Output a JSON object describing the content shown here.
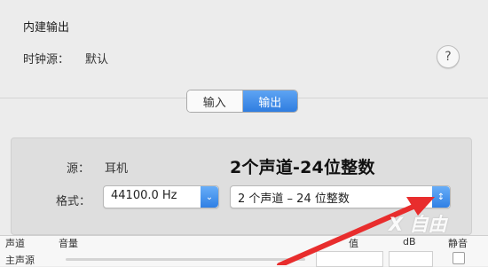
{
  "window": {
    "section_title": "内建输出"
  },
  "clock": {
    "label": "时钟源：",
    "value": "默认"
  },
  "help": {
    "label": "?"
  },
  "tabs": [
    {
      "label": "输入",
      "active": false
    },
    {
      "label": "输出",
      "active": true
    }
  ],
  "format_panel": {
    "source_label": "源：",
    "source_value": "耳机",
    "format_label": "格式：",
    "sample_rate": "44100.0 Hz",
    "channel_format": "2 个声道 – 24 位整数"
  },
  "annotation": {
    "text": "2个声道-24位整数",
    "color": "#e82d2d"
  },
  "table": {
    "headers": [
      "声道",
      "音量",
      "值",
      "dB",
      "静音"
    ],
    "rows": [
      {
        "label": "主声源"
      }
    ]
  },
  "watermark": {
    "text": "X 自由"
  },
  "colors": {
    "accent": "#2f7fe4",
    "arrow": "#e82d2d"
  }
}
